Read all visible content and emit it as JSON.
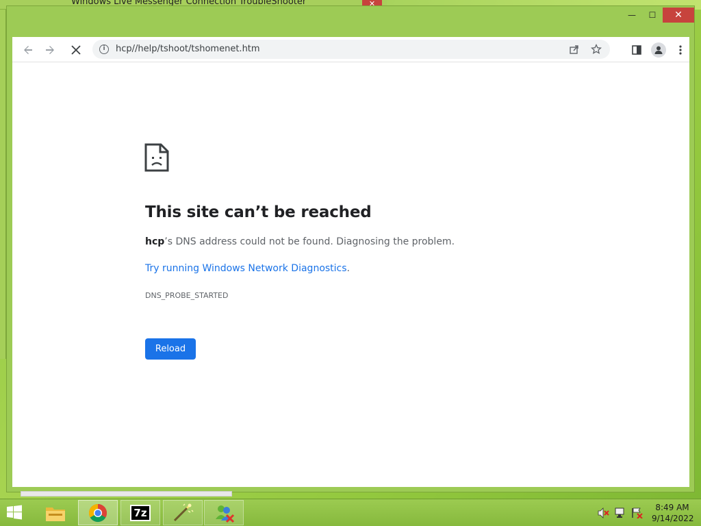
{
  "background_window": {
    "title": "Windows Live Messenger Connection TroubleShooter",
    "close_glyph": "✕"
  },
  "window_controls": {
    "minimize": "—",
    "maximize": "☐",
    "close": "✕"
  },
  "toolbar": {
    "back_icon": "arrow-left-icon",
    "forward_icon": "arrow-right-icon",
    "stop_icon": "stop-icon",
    "url": "hcp//help/tshoot/tshomenet.htm"
  },
  "error_page": {
    "title": "This site can’t be reached",
    "host": "hcp",
    "description_rest": "’s DNS address could not be found. Diagnosing the problem.",
    "diagnostics_link": "Try running Windows Network Diagnostics",
    "diagnostics_suffix": ".",
    "error_code": "DNS_PROBE_STARTED",
    "reload_label": "Reload"
  },
  "taskbar": {
    "items": [
      {
        "name": "file-explorer",
        "icon": "folder-icon"
      },
      {
        "name": "chrome",
        "icon": "chrome-icon"
      },
      {
        "name": "7zip",
        "icon": "7zip-icon",
        "label": "7z"
      },
      {
        "name": "magic-wand-app",
        "icon": "wand-icon"
      },
      {
        "name": "messenger",
        "icon": "messenger-icon"
      }
    ],
    "clock": {
      "time": "8:49 AM",
      "date": "9/14/2022"
    }
  },
  "colors": {
    "accent": "#1a73e8",
    "desktop_green": "#8cc63f",
    "close_red": "#c7433d"
  }
}
